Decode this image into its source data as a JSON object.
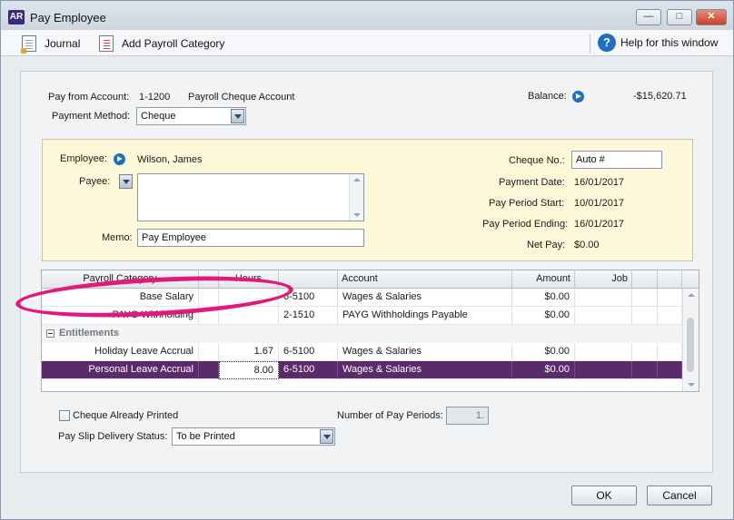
{
  "window": {
    "logo": "AR",
    "title": "Pay Employee"
  },
  "toolbar": {
    "journal_label": "Journal",
    "add_payroll_category_label": "Add Payroll Category",
    "help_label": "Help for this window",
    "help_glyph": "?"
  },
  "header": {
    "pay_from_label": "Pay from Account:",
    "pay_from_account_number": "1-1200",
    "pay_from_account_name": "Payroll Cheque Account",
    "balance_label": "Balance:",
    "balance_value": "-$15,620.71",
    "payment_method_label": "Payment Method:",
    "payment_method_value": "Cheque"
  },
  "employee": {
    "employee_label": "Employee:",
    "employee_value": "Wilson, James",
    "payee_label": "Payee:",
    "payee_value": "",
    "memo_label": "Memo:",
    "memo_value": "Pay Employee",
    "cheque_no_label": "Cheque No.:",
    "cheque_no_value": "Auto #",
    "payment_date_label": "Payment Date:",
    "payment_date_value": "16/01/2017",
    "pay_period_start_label": "Pay Period Start:",
    "pay_period_start_value": "10/01/2017",
    "pay_period_ending_label": "Pay Period Ending:",
    "pay_period_ending_value": "16/01/2017",
    "net_pay_label": "Net Pay:",
    "net_pay_value": "$0.00"
  },
  "grid": {
    "columns": {
      "category": "Payroll Category",
      "hours": "Hours",
      "account": "Account",
      "amount": "Amount",
      "job": "Job"
    },
    "rows": [
      {
        "category": "Base Salary",
        "hours": "",
        "account_no": "6-5100",
        "account": "Wages & Salaries",
        "amount": "$0.00",
        "job": ""
      },
      {
        "category": "PAYG Withholding",
        "hours": "",
        "account_no": "2-1510",
        "account": "PAYG Withholdings Payable",
        "amount": "$0.00",
        "job": ""
      }
    ],
    "section": "Entitlements",
    "entitlement_rows": [
      {
        "category": "Holiday Leave Accrual",
        "hours": "1.67",
        "account_no": "6-5100",
        "account": "Wages & Salaries",
        "amount": "$0.00",
        "job": ""
      },
      {
        "category": "Personal Leave Accrual",
        "hours": "8.00",
        "account_no": "6-5100",
        "account": "Wages & Salaries",
        "amount": "$0.00",
        "job": ""
      }
    ],
    "selected_row_color": "#5a2a6b",
    "highlight_color": "#e0197a"
  },
  "footer": {
    "cheque_printed_label": "Cheque Already Printed",
    "pay_slip_label": "Pay Slip Delivery Status:",
    "pay_slip_value": "To be Printed",
    "num_periods_label": "Number of Pay Periods:",
    "num_periods_value": "1."
  },
  "buttons": {
    "ok": "OK",
    "cancel": "Cancel"
  }
}
